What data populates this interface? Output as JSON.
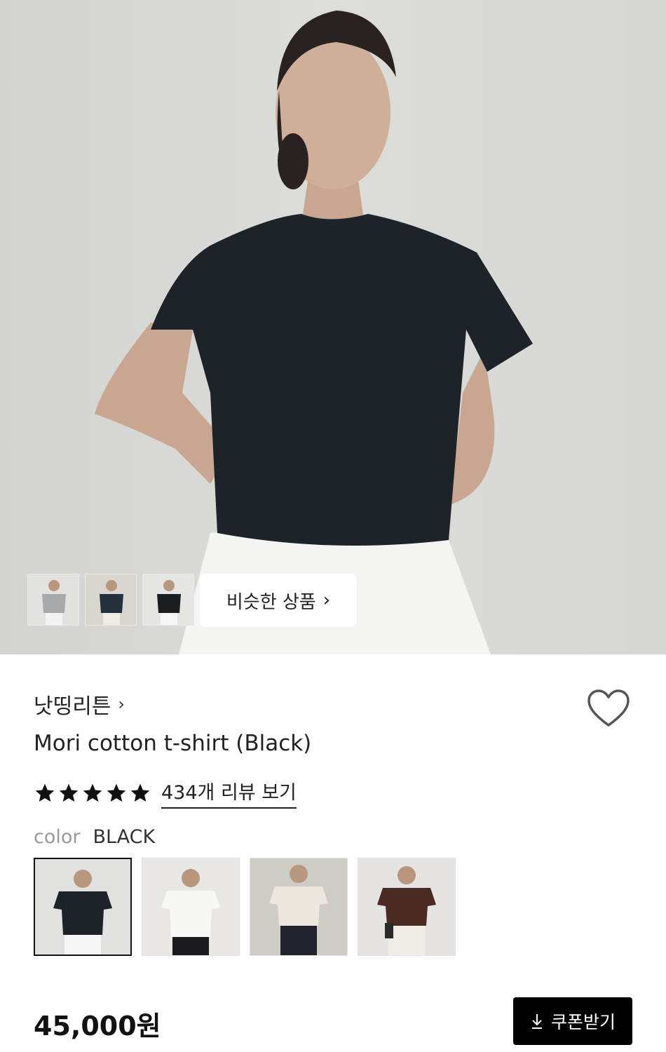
{
  "gallery": {
    "similar_products_label": "비슷한 상품",
    "thumbnail_icons": [
      "gray-tshirt-thumbnail",
      "navy-tshirt-thumbnail",
      "black-tshirt-thumbnail"
    ]
  },
  "product": {
    "brand": "낫띵리튼",
    "title": "Mori cotton t-shirt (Black)",
    "rating_stars": 5,
    "review_link": "434개 리뷰 보기",
    "color_label": "color",
    "color_value": "BLACK",
    "color_options": [
      "black",
      "white",
      "cream",
      "brown"
    ],
    "price": "45,000원",
    "coupon_label": "쿠폰받기"
  },
  "colors": {
    "shirt_black": "#1e2329",
    "coupon_bg": "#000000"
  }
}
